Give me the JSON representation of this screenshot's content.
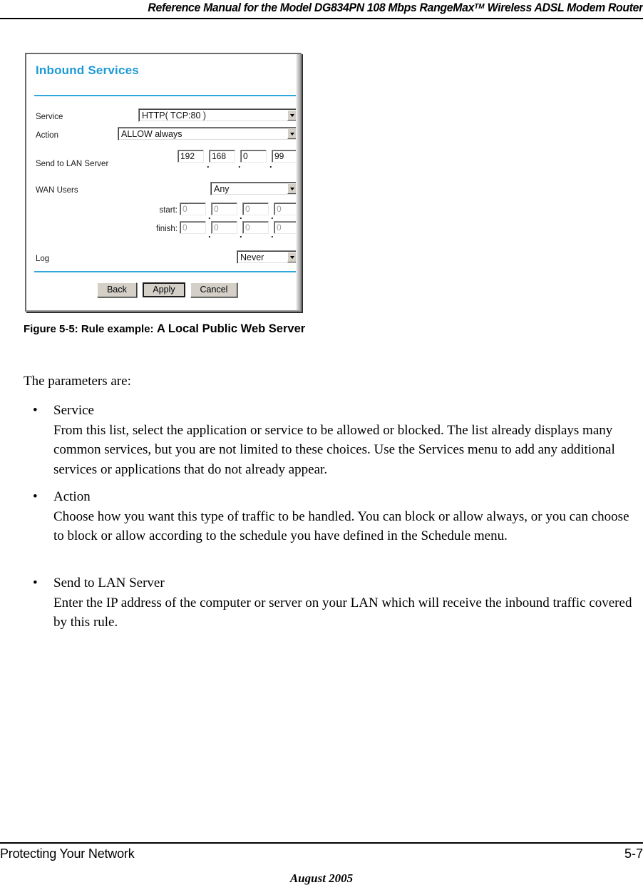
{
  "header": {
    "title_before_tm": "Reference Manual for the Model DG834PN 108 Mbps RangeMax",
    "tm": "TM",
    "title_after_tm": " Wireless ADSL Modem Router"
  },
  "screenshot": {
    "panel_title": "Inbound Services",
    "accent_color": "#1c9ad6",
    "rule_color": "#2ea7dd",
    "fields": {
      "service": {
        "label": "Service",
        "value": "HTTP( TCP:80 )"
      },
      "action": {
        "label": "Action",
        "value": "ALLOW always"
      },
      "send_to_lan_server": {
        "label": "Send to LAN Server",
        "octets": [
          "192",
          "168",
          "0",
          "99"
        ],
        "separator": "."
      },
      "wan_users": {
        "label": "WAN Users",
        "value": "Any",
        "start": {
          "label": "start:",
          "octets": [
            "0",
            "0",
            "0",
            "0"
          ]
        },
        "finish": {
          "label": "finish:",
          "octets": [
            "0",
            "0",
            "0",
            "0"
          ]
        }
      },
      "log": {
        "label": "Log",
        "value": "Never"
      }
    },
    "buttons": {
      "back": "Back",
      "apply": "Apply",
      "cancel": "Cancel"
    }
  },
  "figure": {
    "number": "Figure 5-5:  Rule example:",
    "title": "A Local Public Web Server"
  },
  "content": {
    "lead": "The parameters are:",
    "bullet_mark": "•",
    "bullets": [
      {
        "term": "Service",
        "description": "From this list, select the application or service to be allowed or blocked. The list already displays many common services, but you are not limited to these choices. Use the Services menu to add any additional services or applications that do not already appear."
      },
      {
        "term": "Action",
        "description": "Choose how you want this type of traffic to be handled. You can block or allow always, or you can choose to block or allow according to the schedule you have defined in the Schedule menu."
      },
      {
        "term": "Send to LAN Server",
        "description": "Enter the IP address of the computer or server on your LAN which will receive the inbound traffic covered by this rule."
      }
    ]
  },
  "footer": {
    "chapter": "Protecting Your Network",
    "page_number": "5-7",
    "date": "August 2005"
  }
}
